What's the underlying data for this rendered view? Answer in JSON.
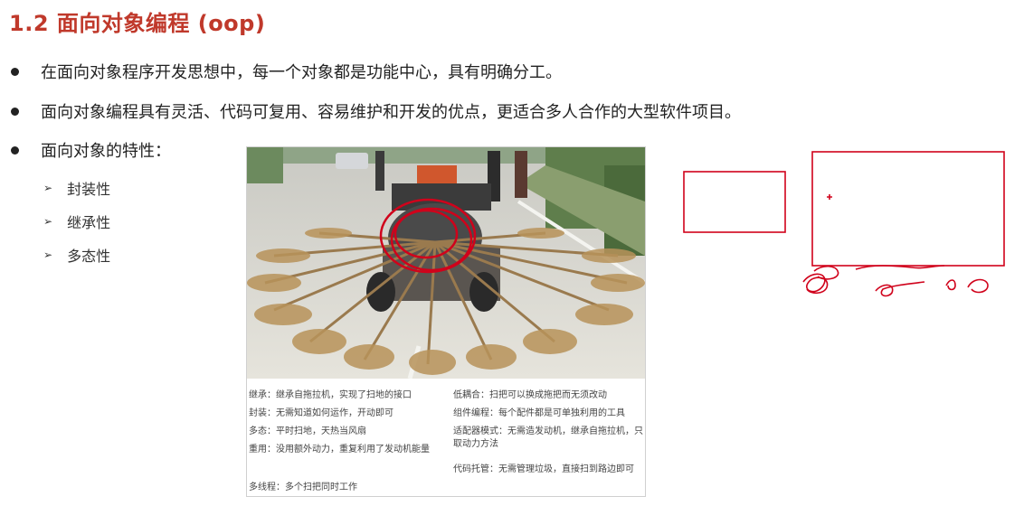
{
  "slide": {
    "title": "1.2 面向对象编程 (oop)",
    "bullets": [
      "在面向对象程序开发思想中，每一个对象都是功能中心，具有明确分工。",
      "面向对象编程具有灵活、代码可复用、容易维护和开发的优点，更适合多人合作的大型软件项目。",
      "面向对象的特性："
    ],
    "features": [
      "封装性",
      "继承性",
      "多态性"
    ]
  },
  "figure": {
    "captions_left": [
      "继承：继承自拖拉机，实现了扫地的接口",
      "封装：无需知道如何运作，开动即可",
      "多态：平时扫地，天热当风扇",
      "重用：没用额外动力，重复利用了发动机能量",
      "多线程：多个扫把同时工作"
    ],
    "captions_right": [
      "低耦合：扫把可以换成拖把而无须改动",
      "组件编程：每个配件都是可单独利用的工具",
      "适配器模式：无需造发动机，继承自拖拉机，只取动力方法",
      "代码托管：无需管理垃圾，直接扫到路边即可"
    ]
  },
  "annotation": {
    "color": "#d0021b"
  }
}
